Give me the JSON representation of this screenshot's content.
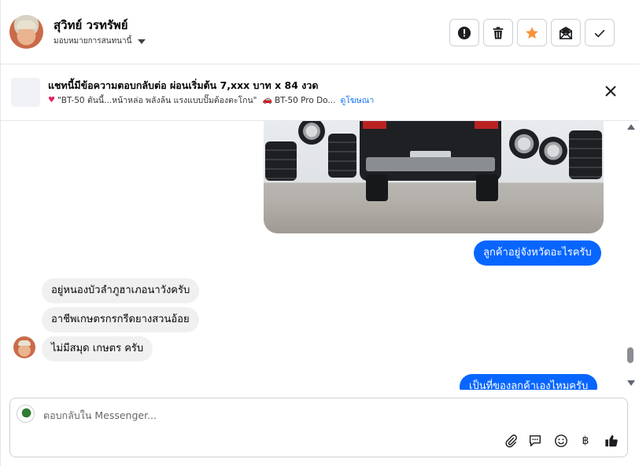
{
  "contact": {
    "name": "สุวิทย์ วรทรัพย์",
    "assign_label": "มอบหมายการสนทนานี้"
  },
  "header_actions": [
    {
      "name": "report-icon",
      "title": "Report"
    },
    {
      "name": "trash-icon",
      "title": "Delete"
    },
    {
      "name": "star-icon",
      "title": "Star"
    },
    {
      "name": "mark-unread-icon",
      "title": "Mark unread"
    },
    {
      "name": "checkmark-icon",
      "title": "Done"
    }
  ],
  "ad_banner": {
    "title": "แชทนี้มีข้อความตอบกลับต่อ ผ่อนเริ่มต้น 7,xxx บาท x 84 งวด",
    "quote": "\"BT-50 ตันนี้...หน้าหล่อ พลังล้น แรงแบบปั๊มต้องตะโกน\"",
    "ad_name": "BT-50 Pro Do...",
    "link_label": "ดูโฆษณา"
  },
  "messages": [
    {
      "direction": "out",
      "text": "ลูกค้าอยู่จังหวัดอะไรครับ"
    },
    {
      "direction": "in",
      "text": "อยู่หนองบัวลำภูฮาเภอนาวังครับ"
    },
    {
      "direction": "in",
      "text": "อาชีพเกษตรกรกรีดยางสวนอ้อย"
    },
    {
      "direction": "in",
      "text": "ไม่มีสมุด เกษตร ครับ"
    },
    {
      "direction": "out",
      "text": "เป็นที่ของลูกค้าเองไหมครับ"
    }
  ],
  "composer": {
    "placeholder": "ตอบกลับใน Messenger...",
    "tools": [
      "attachment-icon",
      "saved-reply-icon",
      "emoji-icon",
      "baht-icon",
      "like-icon"
    ],
    "currency_symbol": "฿"
  },
  "colors": {
    "accent": "#0866ff",
    "incoming_bubble": "#f0f0f0",
    "star": "#f7923a"
  }
}
